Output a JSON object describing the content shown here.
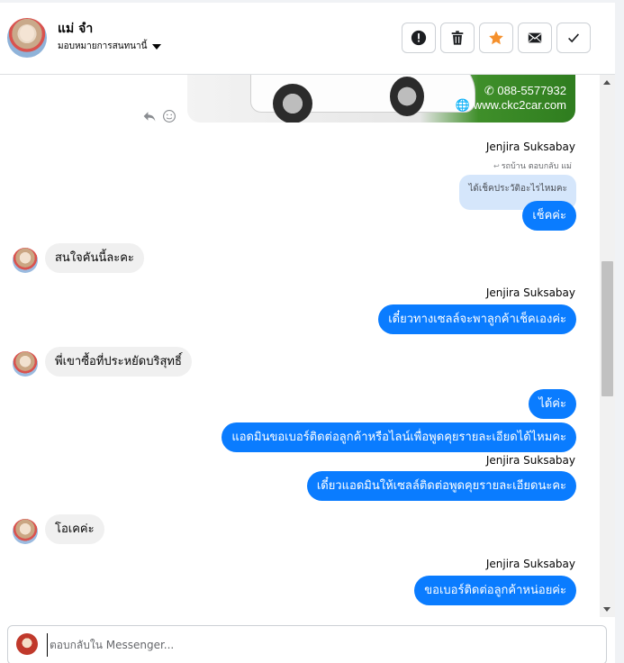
{
  "header": {
    "contact_name": "แม่ จำ",
    "assign_label": "มอบหมายการสนทนานี้",
    "actions": [
      "mark-spam",
      "delete",
      "star",
      "mark-unread",
      "done"
    ],
    "star_color": "#f5902c"
  },
  "image_message": {
    "phone": "088-5577932",
    "website": "www.ckc2car.com"
  },
  "messages": {
    "sender_1": "Jenjira Suksabay",
    "reply_note": "รถบ้าน ตอบกลับ แม่",
    "quoted_text": "ได้เช็คประวัติอะไรไหมคะ",
    "out_1": "เช็คค่ะ",
    "in_1": "สนใจคันนี้ละคะ",
    "sender_2": "Jenjira Suksabay",
    "out_2": "เดี๋ยวทางเซลล์จะพาลูกค้าเช็คเองค่ะ",
    "in_2": "พี่เขาซื้อที่ประหยัดบริสุทธิ์",
    "out_3": "ได้ค่ะ",
    "out_4": "แอดมินขอเบอร์ติดต่อลูกค้าหรือไลน์เพื่อพูดคุยรายละเอียดได้ไหมคะ",
    "sender_3": "Jenjira Suksabay",
    "out_5": "เดี๋ยวแอดมินให้เซลล์ติดต่อพูดคุยรายละเอียดนะคะ",
    "in_3": "โอเคค่ะ",
    "sender_4": "Jenjira Suksabay",
    "out_6": "ขอเบอร์ติดต่อลูกค้าหน่อยค่ะ"
  },
  "composer": {
    "placeholder": "ตอบกลับใน Messenger..."
  },
  "colors": {
    "outgoing_bubble": "#0a7cff",
    "incoming_bubble": "#f0f0f0",
    "quoted_bubble": "#d5e6fb"
  }
}
